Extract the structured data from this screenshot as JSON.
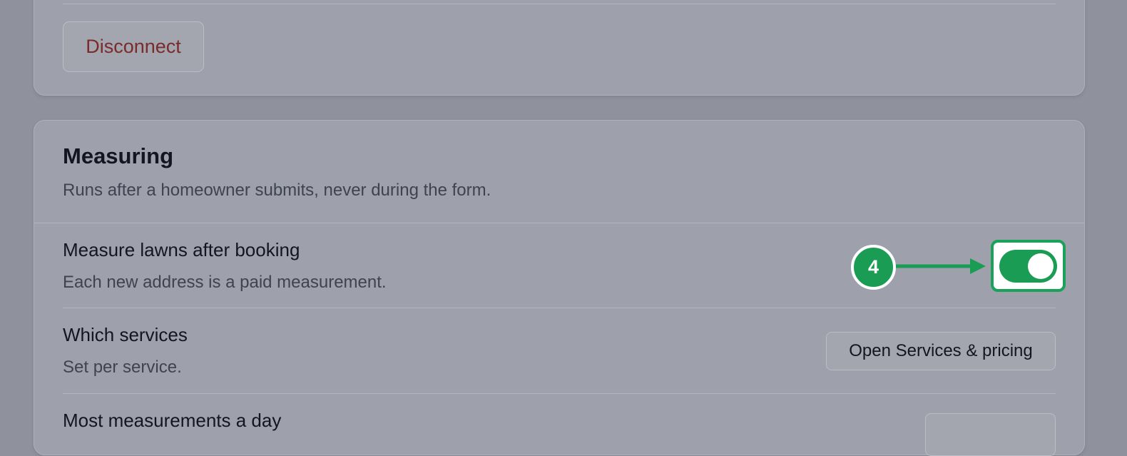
{
  "integration": {
    "disconnect_label": "Disconnect"
  },
  "measuring": {
    "title": "Measuring",
    "subtitle": "Runs after a homeowner submits, never during the form.",
    "rows": [
      {
        "label": "Measure lawns after booking",
        "description": "Each new address is a paid measurement.",
        "control": "toggle",
        "checked": true
      },
      {
        "label": "Which services",
        "description": "Set per service.",
        "control": "button",
        "button_label": "Open Services & pricing"
      },
      {
        "label": "Most measurements a day",
        "control": "button"
      }
    ]
  },
  "annotation": {
    "step_number": "4",
    "color": "#1a9c55"
  },
  "colors": {
    "toggle_on": "#1a9c55",
    "danger_text": "#7a2b2b"
  }
}
